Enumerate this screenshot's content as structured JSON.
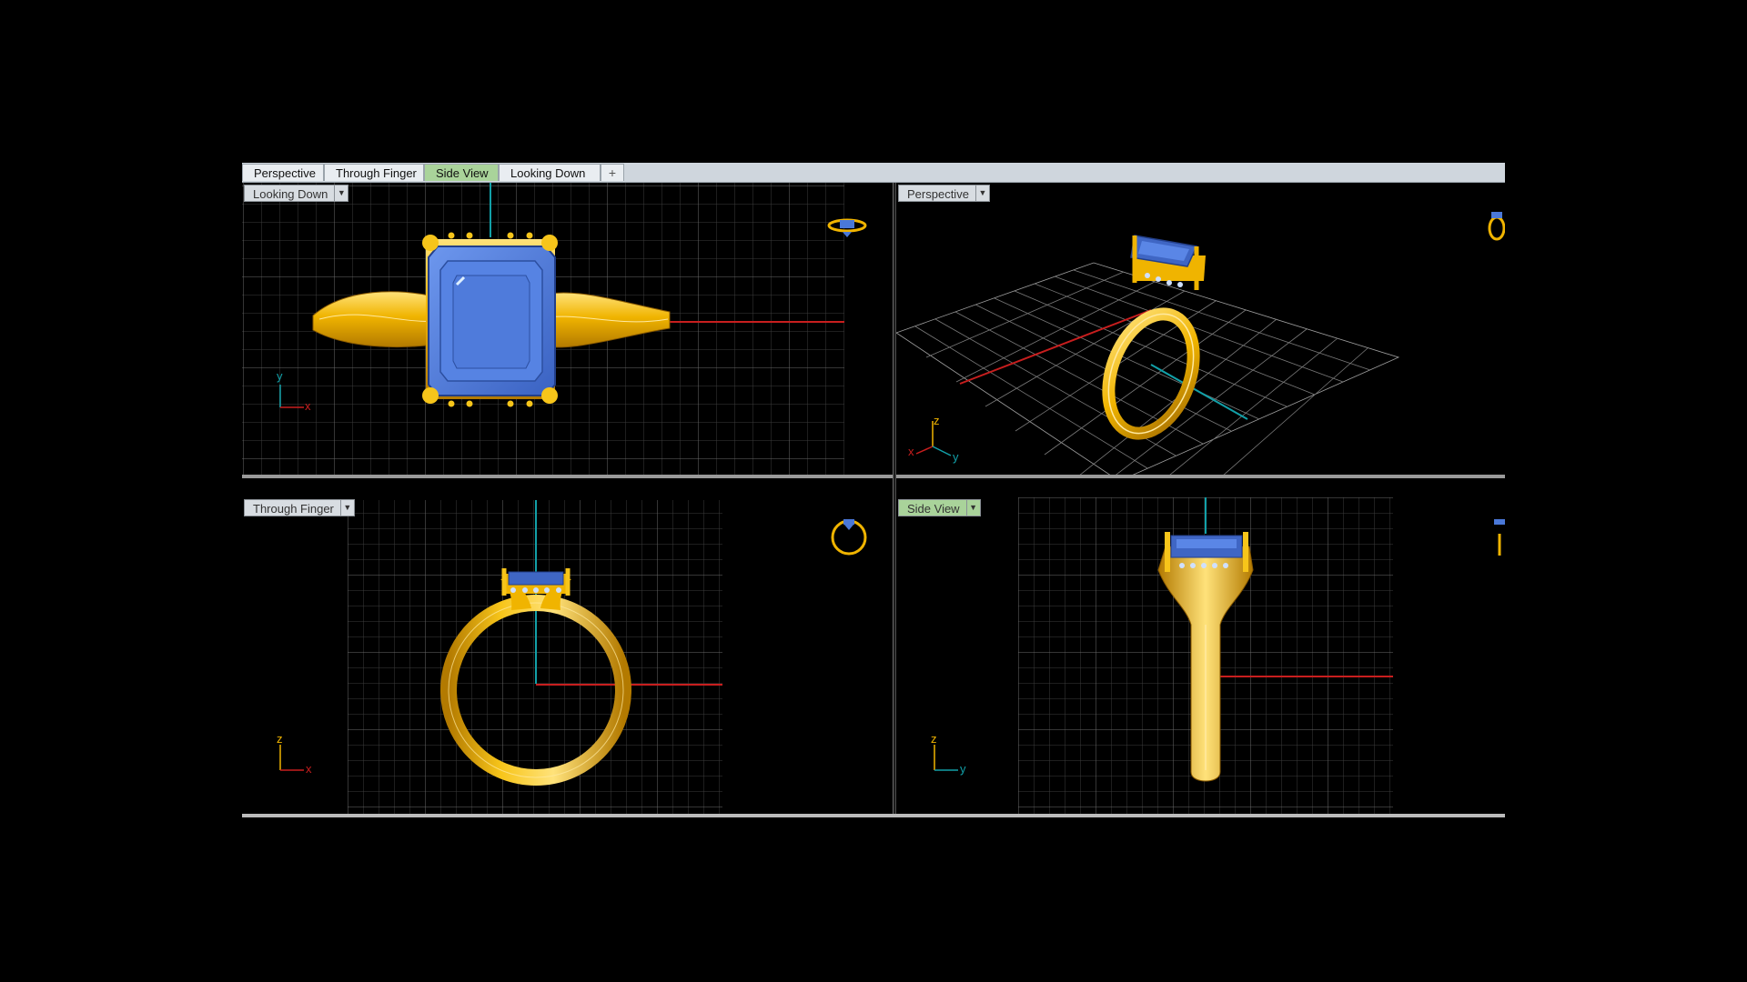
{
  "tabs": [
    {
      "label": "Perspective",
      "active": false
    },
    {
      "label": "Through Finger",
      "active": false
    },
    {
      "label": "Side View",
      "active": true
    },
    {
      "label": "Looking Down",
      "active": false
    },
    {
      "label": "+",
      "active": false
    }
  ],
  "viewports": {
    "top": {
      "label": "Looking Down",
      "axis1": "y",
      "axis2": "x"
    },
    "perspective": {
      "label": "Perspective",
      "axis1": "z",
      "axis2": "y",
      "axis3": "x"
    },
    "front": {
      "label": "Through Finger",
      "axis1": "z",
      "axis2": "x"
    },
    "right": {
      "label": "Side View",
      "axis1": "z",
      "axis2": "y"
    }
  },
  "colors": {
    "gold": "#f0b400",
    "gold_dark": "#a46d00",
    "gem": "#4a78d8",
    "gem_dark": "#2c4fa0",
    "grid": "#5a5a5a",
    "x_axis": "#c81e1e",
    "y_axis": "#12a0a8",
    "active_tab": "#a9d39a"
  }
}
